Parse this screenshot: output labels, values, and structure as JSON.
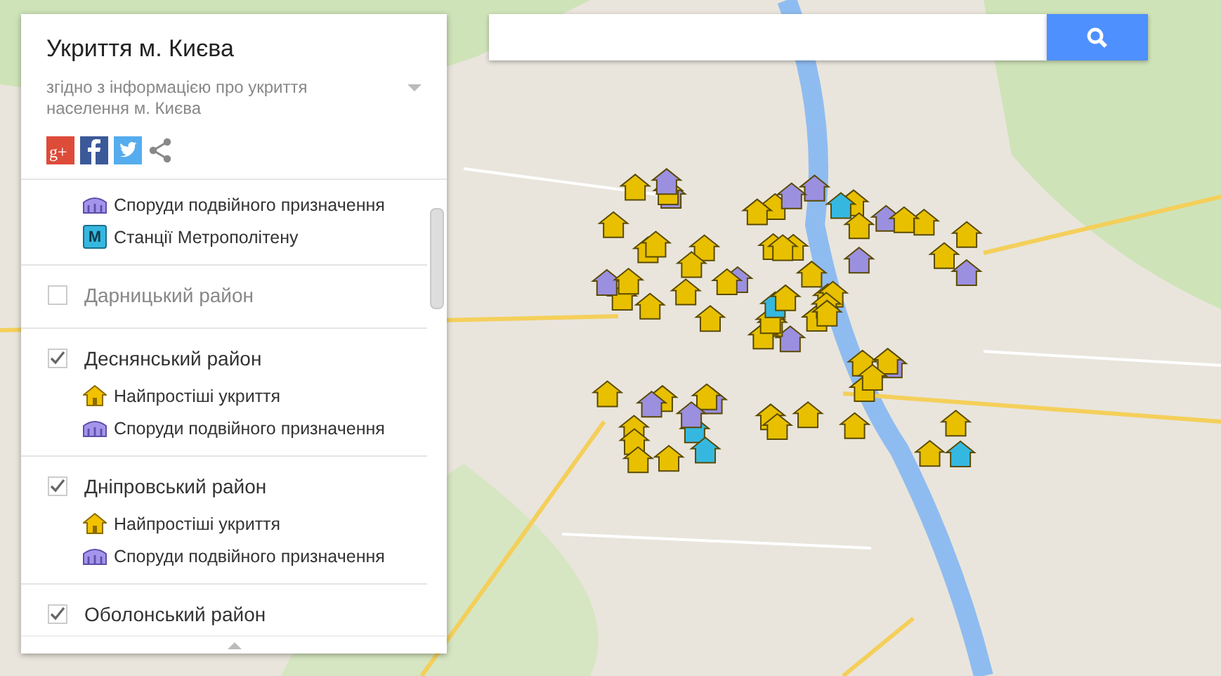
{
  "panel": {
    "title": "Укриття м. Києва",
    "description": "згідно з інформацією про укриття населення м. Києва",
    "gplus_mark": "g+"
  },
  "layers": [
    {
      "items": [
        {
          "label": "Споруди подвійного призначення",
          "kind": "dual"
        },
        {
          "label": "Станції Метрополітену",
          "kind": "metro",
          "badge": "M"
        }
      ]
    },
    {
      "name": "Дарницький район",
      "checked": false
    },
    {
      "name": "Деснянський район",
      "checked": true,
      "items": [
        {
          "label": "Найпростіші укриття",
          "kind": "shelter"
        },
        {
          "label": "Споруди подвійного призначення",
          "kind": "dual"
        }
      ]
    },
    {
      "name": "Дніпровський район",
      "checked": true,
      "items": [
        {
          "label": "Найпростіші укриття",
          "kind": "shelter"
        },
        {
          "label": "Споруди подвійного призначення",
          "kind": "dual"
        }
      ]
    },
    {
      "name": "Оболонський район",
      "checked": true
    }
  ]
}
